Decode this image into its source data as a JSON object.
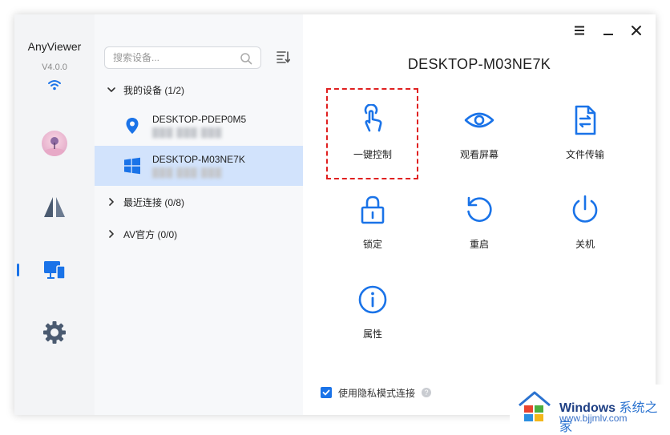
{
  "app": {
    "name": "AnyViewer",
    "version": "V4.0.0"
  },
  "search": {
    "placeholder": "搜索设备..."
  },
  "groups": {
    "my_devices": "我的设备 (1/2)",
    "recent": "最近连接 (0/8)",
    "av_official": "AV官方 (0/0)"
  },
  "devices": [
    {
      "name": "DESKTOP-PDEP0M5",
      "id": "███ ███ ███",
      "icon": "location-pin-icon"
    },
    {
      "name": "DESKTOP-M03NE7K",
      "id": "███ ███ ███",
      "icon": "windows-icon",
      "selected": true
    }
  ],
  "main": {
    "device_title": "DESKTOP-M03NE7K",
    "actions": [
      {
        "label": "一键控制",
        "icon": "touch-hand-icon",
        "highlighted": true
      },
      {
        "label": "观看屏幕",
        "icon": "eye-icon"
      },
      {
        "label": "文件传输",
        "icon": "file-transfer-icon"
      },
      {
        "label": "锁定",
        "icon": "lock-icon"
      },
      {
        "label": "重启",
        "icon": "restart-icon"
      },
      {
        "label": "关机",
        "icon": "power-icon"
      },
      {
        "label": "属性",
        "icon": "info-icon"
      }
    ],
    "privacy_label": "使用隐私模式连接",
    "privacy_checked": true
  },
  "watermark": {
    "brand": "Windows",
    "brand_cn": "系统之家",
    "url": "www.bjjmlv.com"
  },
  "colors": {
    "accent": "#1a73e8",
    "selected_row": "#d2e3fc",
    "highlight_dash": "#e02020",
    "rail_bg": "#f3f4f6",
    "list_bg": "#f7f8fa"
  }
}
